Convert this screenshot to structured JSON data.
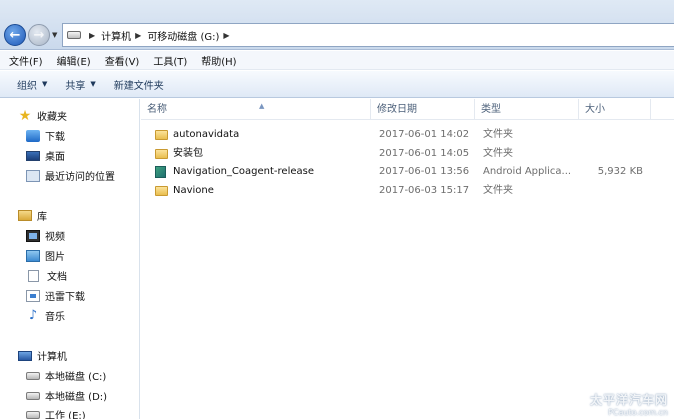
{
  "address_bar": {
    "breadcrumbs": [
      "计算机",
      "可移动磁盘 (G:)"
    ]
  },
  "menubar": {
    "items": [
      "文件(F)",
      "编辑(E)",
      "查看(V)",
      "工具(T)",
      "帮助(H)"
    ]
  },
  "commandbar": {
    "organize": "组织",
    "share": "共享",
    "new_folder": "新建文件夹"
  },
  "navigation": {
    "favorites": {
      "label": "收藏夹",
      "items": [
        "下载",
        "桌面",
        "最近访问的位置"
      ]
    },
    "libraries": {
      "label": "库",
      "items": [
        "视频",
        "图片",
        "文档",
        "迅雷下载",
        "音乐"
      ]
    },
    "computer": {
      "label": "计算机",
      "items": [
        "本地磁盘 (C:)",
        "本地磁盘 (D:)",
        "工作 (E:)"
      ]
    }
  },
  "columns": {
    "name": "名称",
    "date": "修改日期",
    "type": "类型",
    "size": "大小"
  },
  "files": [
    {
      "name": "autonavidata",
      "date": "2017-06-01 14:02",
      "type": "文件夹",
      "size": "",
      "icon": "folder-icon"
    },
    {
      "name": "安装包",
      "date": "2017-06-01 14:05",
      "type": "文件夹",
      "size": "",
      "icon": "folder-icon"
    },
    {
      "name": "Navigation_Coagent-release",
      "date": "2017-06-01 13:56",
      "type": "Android Applica...",
      "size": "5,932 KB",
      "icon": "apk-file-icon"
    },
    {
      "name": "Navione",
      "date": "2017-06-03 15:17",
      "type": "文件夹",
      "size": "",
      "icon": "folder-icon"
    }
  ],
  "watermark": {
    "cn": "太平洋汽车网",
    "en": "PCauto.com.cn"
  }
}
